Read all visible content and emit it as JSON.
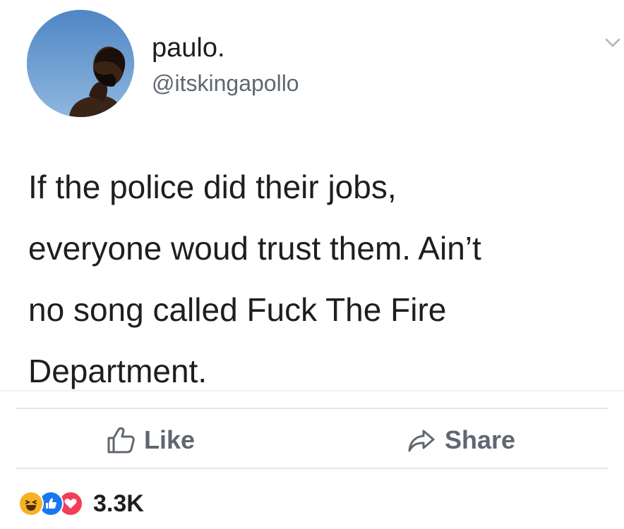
{
  "post": {
    "author": {
      "display_name": "paulo.",
      "handle": "@itskingapollo"
    },
    "text_lines": [
      "If the police did their jobs,",
      "everyone woud trust them. Ain’t",
      "no song called Fuck The Fire",
      "Department."
    ]
  },
  "actions": {
    "like_label": "Like",
    "share_label": "Share"
  },
  "reactions": {
    "icons": [
      "haha-icon",
      "like-icon",
      "love-icon"
    ],
    "count": "3.3K"
  },
  "colors": {
    "text": "#1c1e21",
    "secondary_text": "#606770",
    "like_blue": "#1877f2",
    "love_red": "#f33e58",
    "haha_yellow": "#f7b125"
  }
}
